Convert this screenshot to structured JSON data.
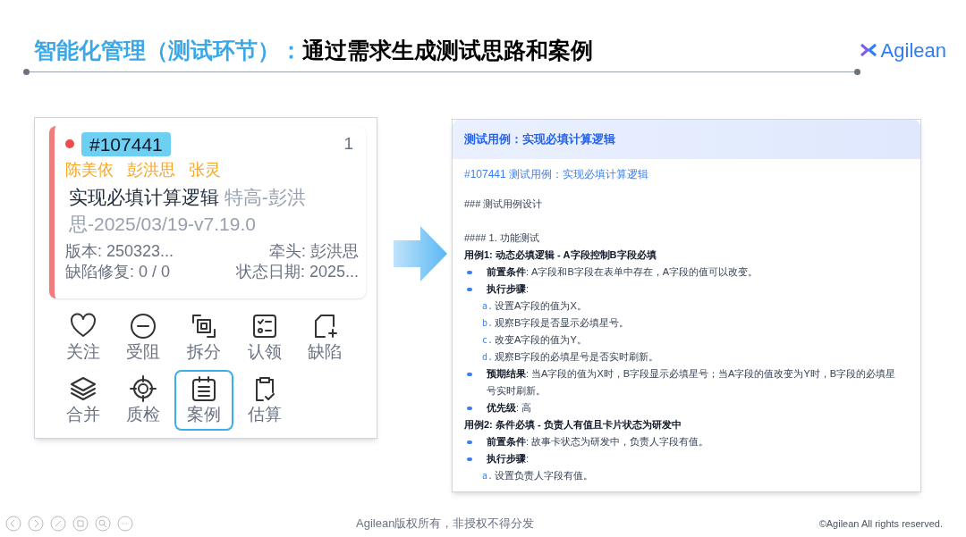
{
  "slide_title": {
    "highlight": "智能化管理（测试环节）：",
    "rest": "通过需求生成测试思路和案例"
  },
  "logo": {
    "text": "Agilean"
  },
  "card": {
    "id_badge": "#107441",
    "count": "1",
    "assignees": [
      "陈美依",
      "彭洪思",
      "张灵"
    ],
    "title": "实现必填计算逻辑",
    "title_suffix": "特高-彭洪思-2025/03/19-v7.19.0",
    "meta": [
      [
        "版本: 250323...",
        "牵头: 彭洪思"
      ],
      [
        "缺陷修复: 0 / 0",
        "状态日期: 2025..."
      ]
    ],
    "actions": [
      {
        "label": "关注",
        "selected": false
      },
      {
        "label": "受阻",
        "selected": false
      },
      {
        "label": "拆分",
        "selected": false
      },
      {
        "label": "认领",
        "selected": false
      },
      {
        "label": "缺陷",
        "selected": false
      },
      {
        "label": "合并",
        "selected": false
      },
      {
        "label": "质检",
        "selected": false
      },
      {
        "label": "案例",
        "selected": true
      },
      {
        "label": "估算",
        "selected": false
      }
    ]
  },
  "panel": {
    "title": "测试用例：实现必填计算逻辑",
    "blocks": [
      {
        "kind": "link",
        "text": "#107441 测试用例：实现必填计算逻辑"
      },
      {
        "kind": "heading",
        "text": "### 测试用例设计"
      },
      {
        "kind": "subheading",
        "text": "#### 1. 功能测试"
      },
      {
        "kind": "case",
        "text": "用例1: 动态必填逻辑 - A字段控制B字段必填"
      },
      {
        "kind": "bullet",
        "text": "**前置条件**: A字段和B字段在表单中存在，A字段的值可以改变。"
      },
      {
        "kind": "bullet",
        "text": "**执行步骤**:"
      },
      {
        "kind": "step",
        "marker": "a.",
        "text": "设置A字段的值为X。"
      },
      {
        "kind": "step",
        "marker": "b.",
        "text": "观察B字段是否显示必填星号。"
      },
      {
        "kind": "step",
        "marker": "c.",
        "text": "改变A字段的值为Y。"
      },
      {
        "kind": "step",
        "marker": "d.",
        "text": "观察B字段的必填星号是否实时刷新。"
      },
      {
        "kind": "bullet",
        "text": "**预期结果**: 当A字段的值为X时，B字段显示必填星号；当A字段的值改变为Y时，B字段的必填星号实时刷新。"
      },
      {
        "kind": "bullet",
        "text": "**优先级**: 高"
      },
      {
        "kind": "case",
        "text": "用例2: 条件必填 - 负责人有值且卡片状态为研发中"
      },
      {
        "kind": "bullet",
        "text": "**前置条件**: 故事卡状态为研发中，负责人字段有值。"
      },
      {
        "kind": "bullet",
        "text": "**执行步骤**:"
      },
      {
        "kind": "step",
        "marker": "a.",
        "text": "设置负责人字段有值。"
      }
    ]
  },
  "footer": {
    "center": "Agilean版权所有，非授权不得分发",
    "right": "©Agilean All rights reserved."
  }
}
